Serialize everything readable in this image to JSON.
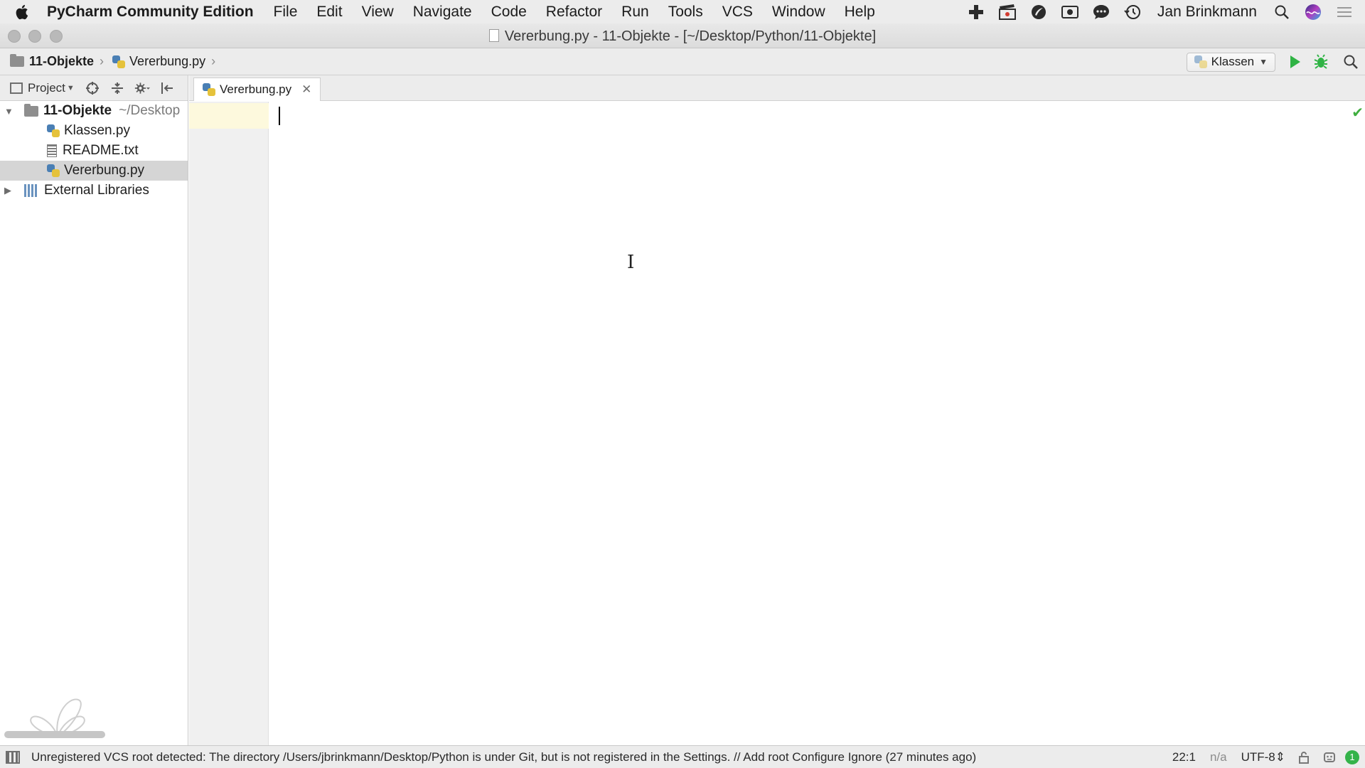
{
  "menubar": {
    "app_name": "PyCharm Community Edition",
    "items": [
      "File",
      "Edit",
      "View",
      "Navigate",
      "Code",
      "Refactor",
      "Run",
      "Tools",
      "VCS",
      "Window",
      "Help"
    ],
    "user": "Jan Brinkmann"
  },
  "window": {
    "title": "Vererbung.py - 11-Objekte - [~/Desktop/Python/11-Objekte]"
  },
  "navbar": {
    "breadcrumb_project": "11-Objekte",
    "breadcrumb_file": "Vererbung.py",
    "run_config": "Klassen"
  },
  "project_panel": {
    "title": "Project",
    "root": {
      "name": "11-Objekte",
      "path": "~/Desktop"
    },
    "files": [
      "Klassen.py",
      "README.txt",
      "Vererbung.py"
    ],
    "selected_file": "Vererbung.py",
    "external": "External Libraries"
  },
  "editor": {
    "active_tab": "Vererbung.py",
    "content": ""
  },
  "statusbar": {
    "message": "Unregistered VCS root detected: The directory /Users/jbrinkmann/Desktop/Python is under Git, but is not registered in the Settings. // Add root  Configure  Ignore (27 minutes ago)",
    "position": "22:1",
    "line_separator": "n/a",
    "encoding": "UTF-8⇕",
    "notifications": "1"
  },
  "colors": {
    "run": "#2fb344",
    "python_blue": "#4a7fb4",
    "python_yellow": "#e5c23b",
    "ok_check": "#3fae3f"
  }
}
